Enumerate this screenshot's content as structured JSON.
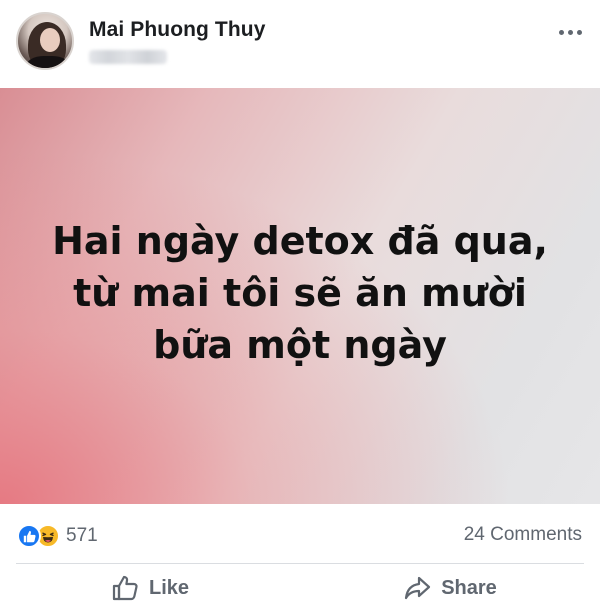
{
  "post": {
    "author_name": "Mai Phuong Thuy",
    "image_text_lines": [
      "Hai ngày detox đã qua,",
      "từ mai tôi sẽ ăn mười",
      "bữa một ngày"
    ],
    "reaction_count": "571",
    "comments_label": "24 Comments",
    "reaction_icons": [
      "like-icon",
      "haha-icon"
    ]
  },
  "actions": {
    "like_label": "Like",
    "share_label": "Share"
  },
  "colors": {
    "like_blue": "#1877f2",
    "haha_yellow": "#f7b928",
    "secondary_text": "#606770"
  }
}
